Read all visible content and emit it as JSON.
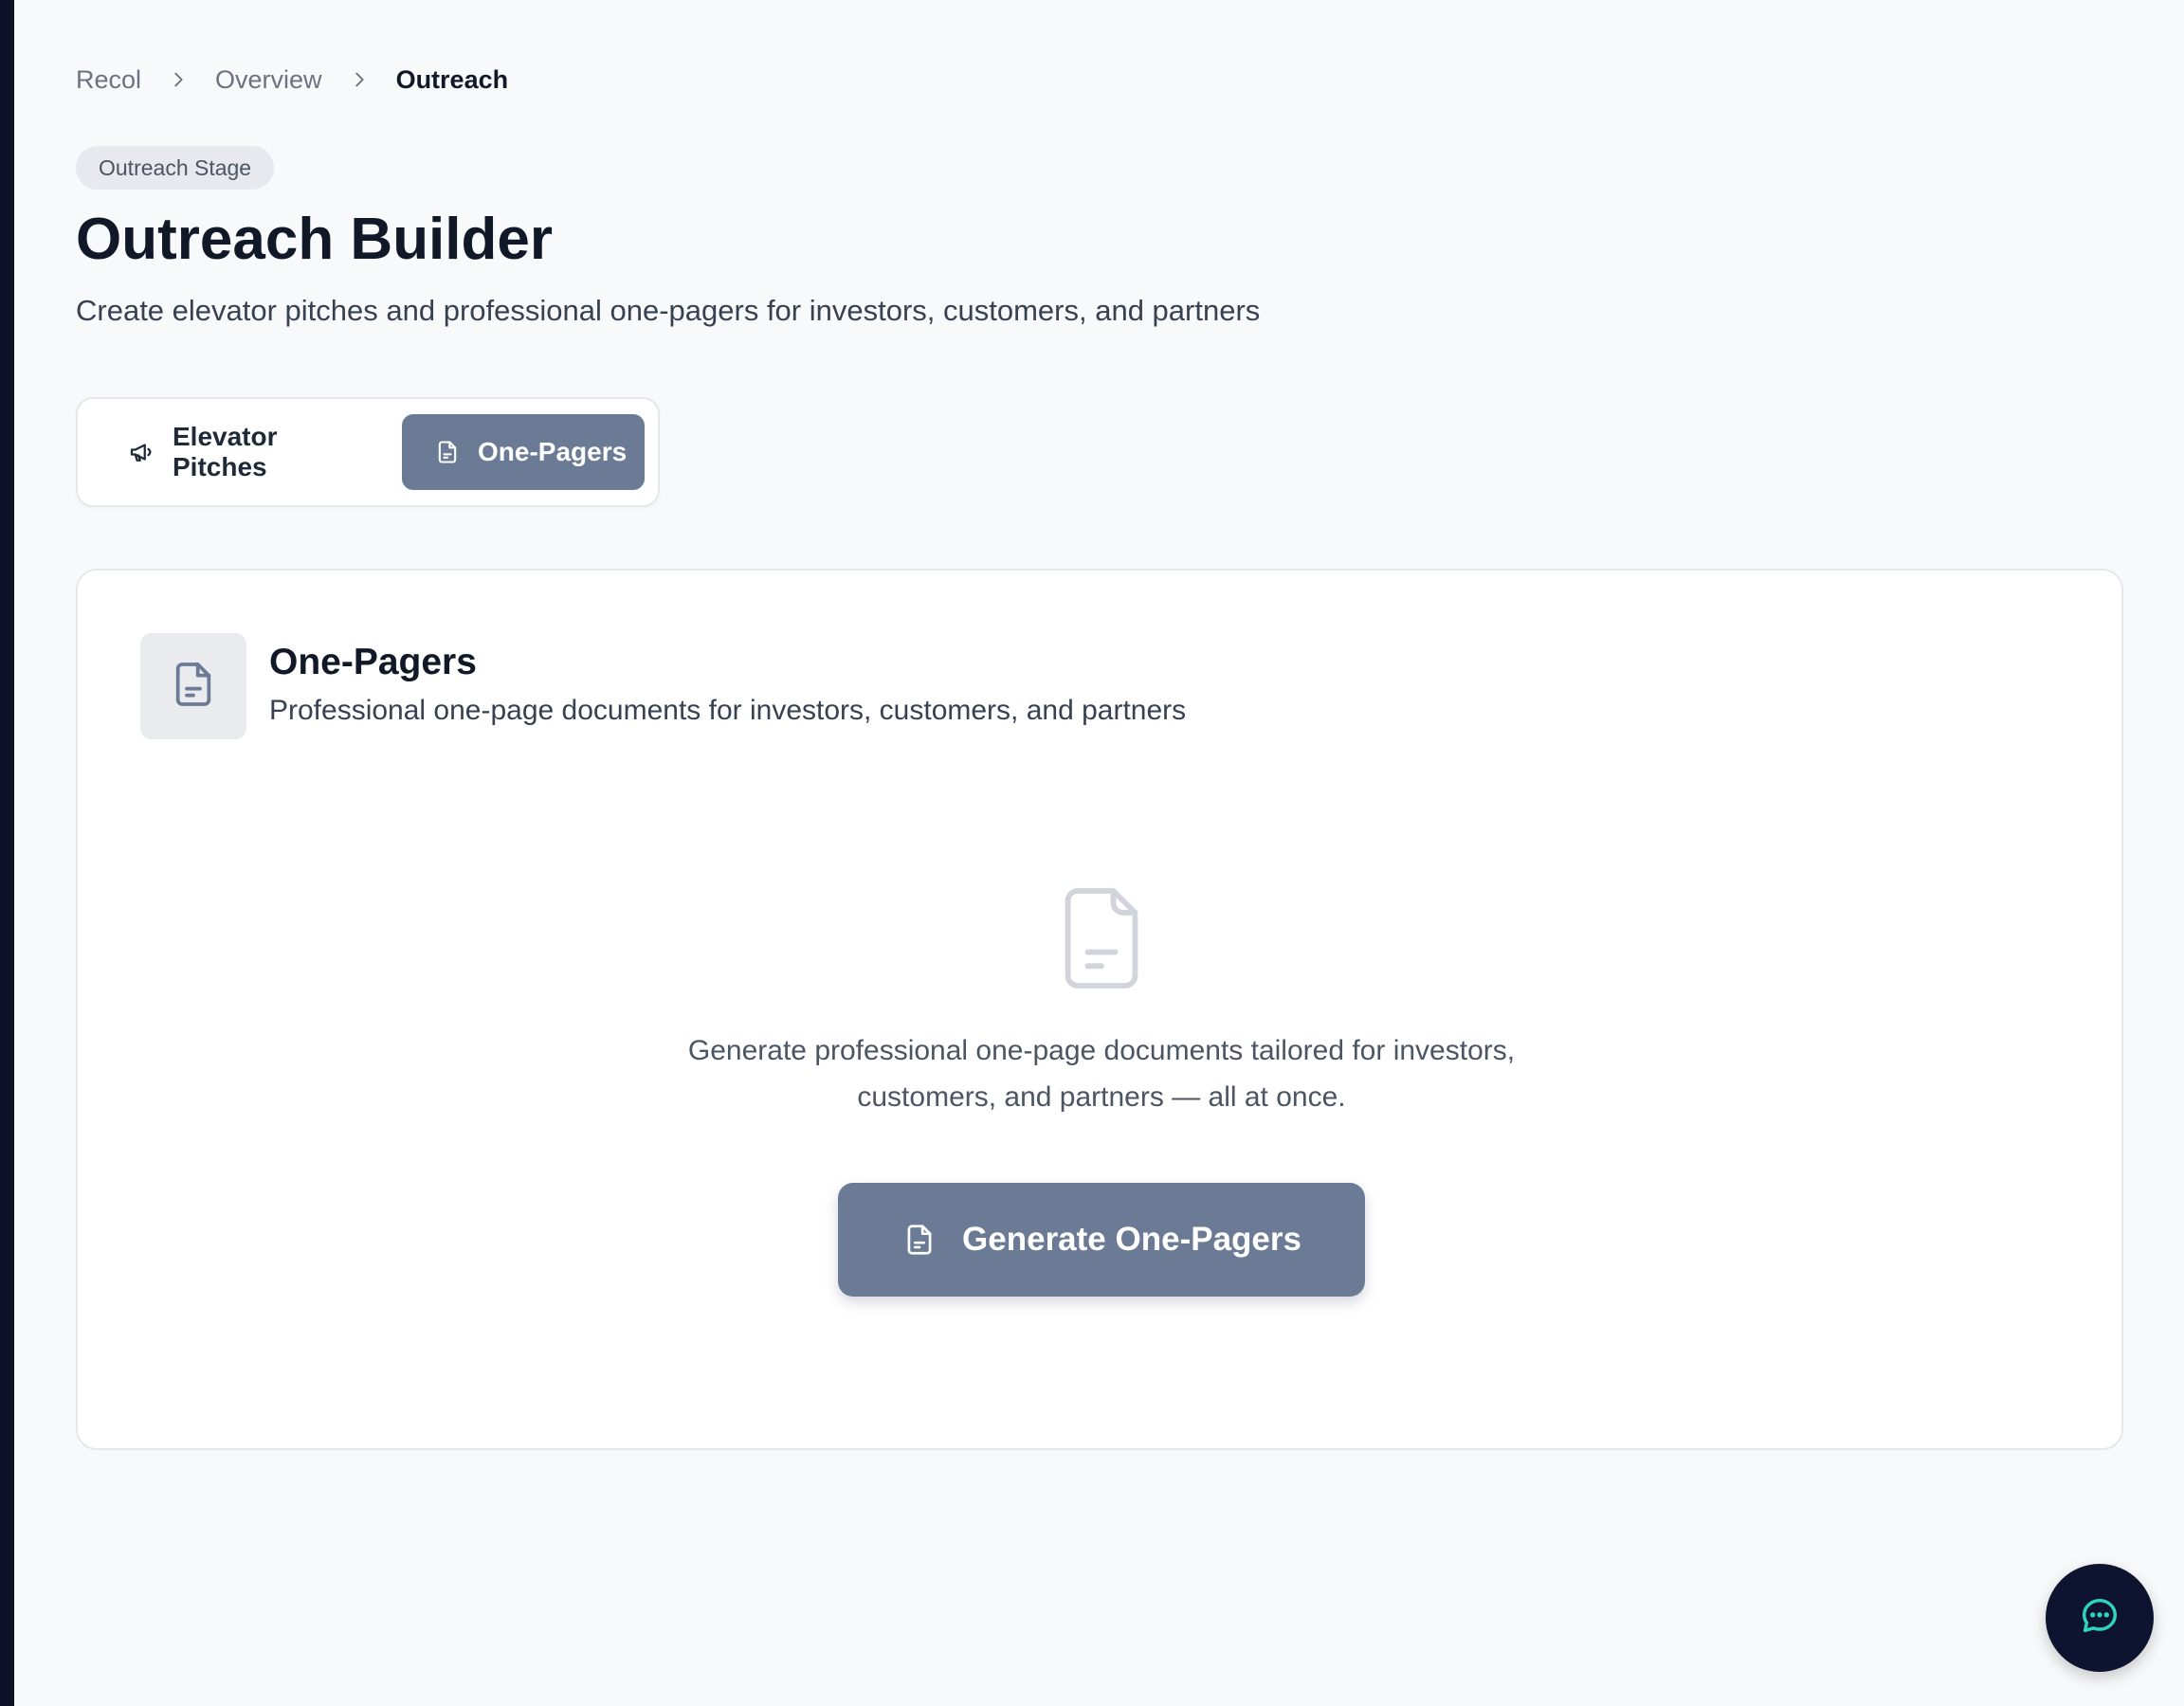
{
  "breadcrumb": {
    "items": [
      "Recol",
      "Overview",
      "Outreach"
    ]
  },
  "stage_badge": "Outreach Stage",
  "page": {
    "title": "Outreach Builder",
    "subtitle": "Create elevator pitches and professional one-pagers for investors, customers, and partners"
  },
  "tabs": [
    {
      "label": "Elevator Pitches",
      "icon": "megaphone-icon",
      "active": false
    },
    {
      "label": "One-Pagers",
      "icon": "file-text-icon",
      "active": true
    }
  ],
  "card": {
    "icon": "file-text-icon",
    "title": "One-Pagers",
    "description": "Professional one-page documents for investors, customers, and partners",
    "empty_state": {
      "icon": "file-text-icon",
      "line1": "Generate professional one-page documents tailored for investors,",
      "line2": "customers, and partners — all at once."
    },
    "generate_button": "Generate One-Pagers"
  },
  "chat_fab": {
    "icon": "chat-bubble-icon"
  },
  "colors": {
    "accent": "#6b7a95",
    "background": "#f8f9fb",
    "fab": "#0e1430",
    "fab_icon": "#2dd4bf"
  }
}
